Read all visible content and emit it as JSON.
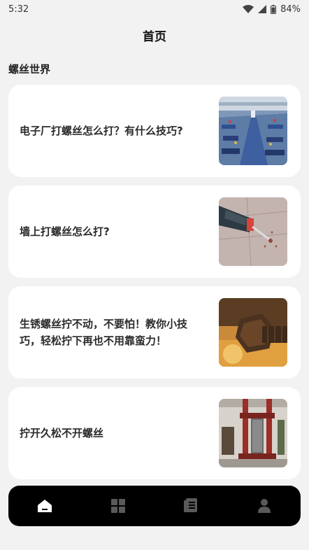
{
  "status": {
    "time": "5:32",
    "battery": "84%"
  },
  "header": {
    "title": "首页"
  },
  "section": {
    "title": "螺丝世界"
  },
  "articles": [
    {
      "title": "电子厂打螺丝怎么打？有什么技巧?",
      "thumb_icon": "factory-floor-photo"
    },
    {
      "title": "墙上打螺丝怎么打?",
      "thumb_icon": "power-drill-photo"
    },
    {
      "title": "生锈螺丝拧不动，不要怕！教你小技巧，轻松拧下再也不用靠蛮力！",
      "thumb_icon": "rusty-bolt-photo"
    },
    {
      "title": "拧开久松不开螺丝",
      "thumb_icon": "press-machine-photo"
    }
  ],
  "nav": {
    "items": [
      {
        "icon": "home-icon",
        "active": true
      },
      {
        "icon": "grid-icon",
        "active": false
      },
      {
        "icon": "document-icon",
        "active": false
      },
      {
        "icon": "profile-icon",
        "active": false
      }
    ],
    "active_color": "#ffffff",
    "inactive_color": "#5a5a5a"
  }
}
